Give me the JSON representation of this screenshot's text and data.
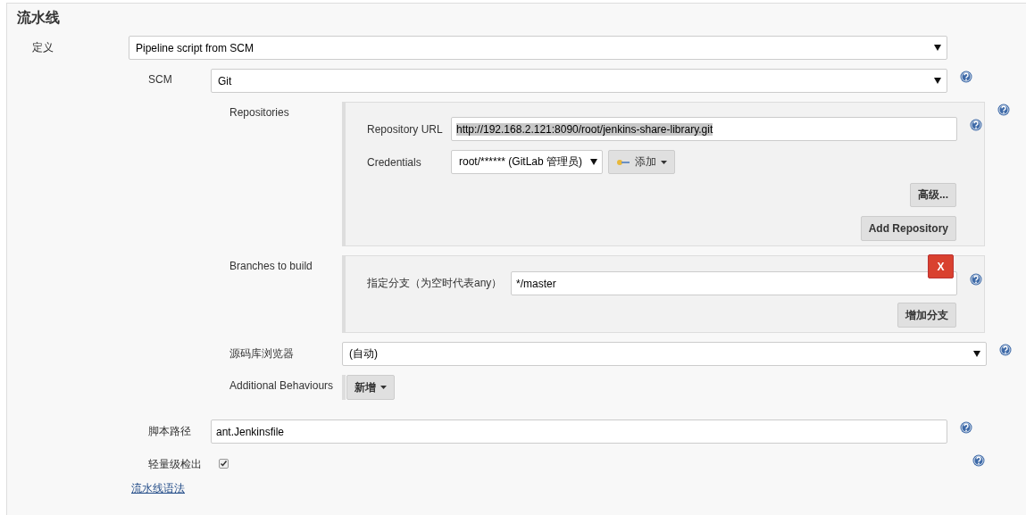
{
  "title": "流水线",
  "definition": {
    "label": "定义",
    "value": "Pipeline script from SCM"
  },
  "scm": {
    "label": "SCM",
    "value": "Git",
    "help": true
  },
  "repositories": {
    "label": "Repositories",
    "help": true,
    "url": {
      "label": "Repository URL",
      "value": "http://192.168.2.121:8090/root/jenkins-share-library.git",
      "highlighted": true,
      "help": true
    },
    "credentials": {
      "label": "Credentials",
      "value": "root/****** (GitLab 管理员)",
      "add_button": "添加"
    },
    "buttons": [
      "高级...",
      "Add Repository"
    ]
  },
  "branches": {
    "label": "Branches to build",
    "delete_button": "X",
    "specifier": {
      "label": "指定分支（为空时代表any）",
      "value": "*/master",
      "help": true
    },
    "add_button": "增加分支"
  },
  "browser": {
    "label": "源码库浏览器",
    "value": "(自动)",
    "help": true
  },
  "behaviours": {
    "label": "Additional Behaviours",
    "add_button": "新增"
  },
  "script_path": {
    "label": "脚本路径",
    "value": "ant.Jenkinsfile",
    "help": true
  },
  "lightweight_checkout": {
    "label": "轻量级检出",
    "checked": true,
    "help": true
  },
  "syntax_link": "流水线语法"
}
